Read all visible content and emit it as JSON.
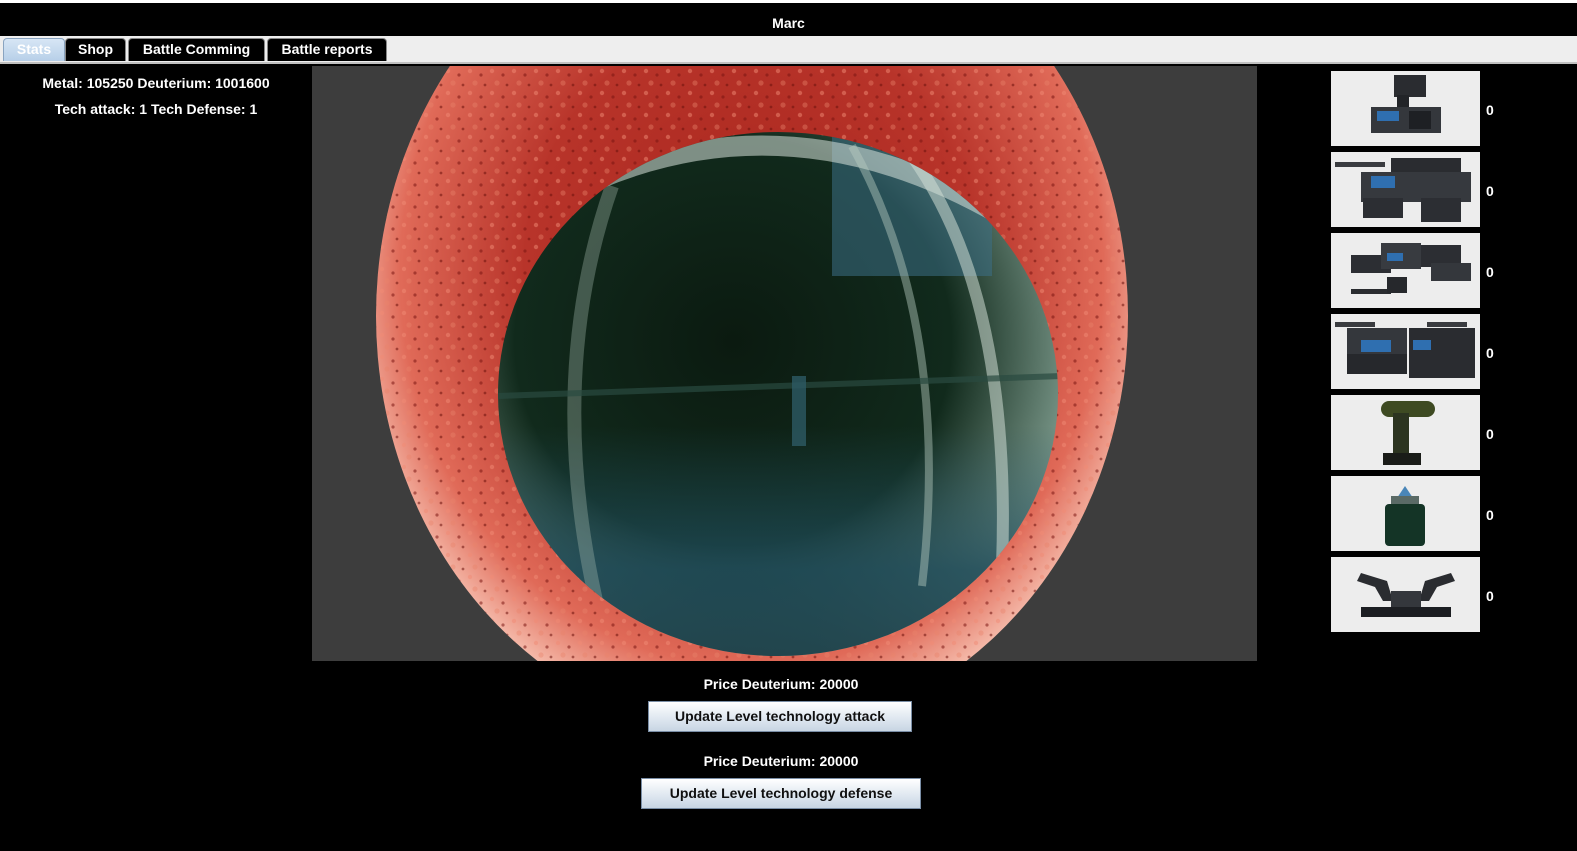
{
  "window": {
    "title": "Marc"
  },
  "tabs": [
    {
      "label": "Stats"
    },
    {
      "label": "Shop"
    },
    {
      "label": "Battle Comming"
    },
    {
      "label": "Battle reports"
    }
  ],
  "stats": {
    "metal_label": "Metal: 105250",
    "deuterium_label": "Deuterium: 1001600",
    "tech_attack_label": "Tech attack: 1",
    "tech_defense_label": "Tech Defense: 1"
  },
  "units": [
    {
      "icon": "light-fighter-ship-icon",
      "count": "0"
    },
    {
      "icon": "heavy-fighter-ship-icon",
      "count": "0"
    },
    {
      "icon": "cruiser-ship-icon",
      "count": "0"
    },
    {
      "icon": "battleship-icon",
      "count": "0"
    },
    {
      "icon": "cannon-turret-icon",
      "count": "0"
    },
    {
      "icon": "rocket-launcher-icon",
      "count": "0"
    },
    {
      "icon": "twin-cannon-defense-icon",
      "count": "0"
    }
  ],
  "upgrades": {
    "attack": {
      "price_label": "Price Deuterium: 20000",
      "button_label": "Update Level technology attack"
    },
    "defense": {
      "price_label": "Price Deuterium: 20000",
      "button_label": "Update Level technology defense"
    }
  },
  "colors": {
    "sun": "#c8342a",
    "planet": "#0f2418",
    "viewport_bg": "#3d3d3d",
    "active_tab": "#c6daf0"
  }
}
